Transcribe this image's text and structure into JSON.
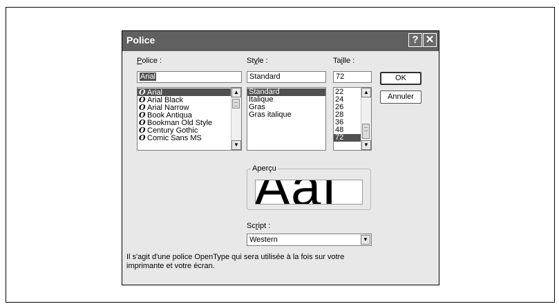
{
  "dialog": {
    "title": "Police",
    "help_button": "?",
    "close_button": "✕"
  },
  "font": {
    "label_prefix_ul": "P",
    "label_rest": "olice :",
    "value": "Arial",
    "items": [
      "Arial",
      "Arial Black",
      "Arial Narrow",
      "Book Antiqua",
      "Bookman Old Style",
      "Century Gothic",
      "Comic Sans MS"
    ],
    "selected_index": 0,
    "opentype_glyph": "O"
  },
  "style": {
    "label_pre": "St",
    "label_ul": "y",
    "label_post": "le :",
    "value": "Standard",
    "items": [
      "Standard",
      "Italique",
      "Gras",
      "Gras italique"
    ],
    "selected_index": 0
  },
  "size": {
    "label_pre": "Ta",
    "label_ul": "i",
    "label_post": "lle :",
    "value": "72",
    "items": [
      "22",
      "24",
      "26",
      "28",
      "36",
      "48",
      "72"
    ],
    "selected_index": 6
  },
  "buttons": {
    "ok": "OK",
    "cancel": "Annuler"
  },
  "preview": {
    "label": "Aperçu",
    "sample": "AaI"
  },
  "script": {
    "label_pre": "Sc",
    "label_ul": "r",
    "label_post": "ipt :",
    "value": "Western"
  },
  "description": "Il s'agit d'une police OpenType qui sera utilisée à la fois sur votre imprimante et votre écran.",
  "icons": {
    "scroll_up": "▲",
    "scroll_down": "▼",
    "dropdown": "▼"
  }
}
